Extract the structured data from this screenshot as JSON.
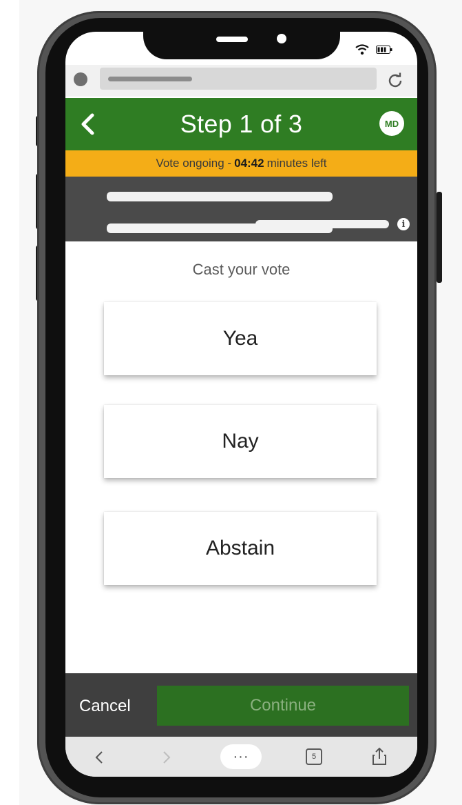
{
  "header": {
    "title": "Step 1 of 3",
    "avatar_initials": "MD",
    "back_icon": "chevron-left-icon",
    "color": "#2f7d23"
  },
  "timer_banner": {
    "prefix": "Vote ongoing -",
    "time": "04:42",
    "suffix": "minutes left",
    "color": "#f4ad17"
  },
  "info_band": {
    "icon": "info-icon",
    "color": "#4a4a4a"
  },
  "vote": {
    "prompt": "Cast your vote",
    "options": [
      "Yea",
      "Nay",
      "Abstain"
    ]
  },
  "actions": {
    "cancel_label": "Cancel",
    "continue_label": "Continue",
    "continue_color": "#2c7021"
  },
  "browser": {
    "reload_icon": "reload-icon",
    "tab_count": "5",
    "menu_label": "···",
    "toolbar_icons": [
      "back-arrow-icon",
      "forward-arrow-icon",
      "more-icon",
      "tabs-icon",
      "share-icon"
    ]
  },
  "status_bar": {
    "icons": [
      "wifi-icon",
      "battery-icon"
    ]
  }
}
